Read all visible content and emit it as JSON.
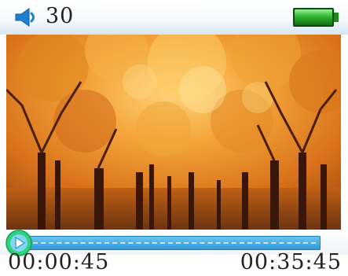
{
  "status": {
    "volume_icon": "speaker-icon",
    "volume_value": "30",
    "battery_icon": "battery-icon",
    "battery_level": 1.0,
    "battery_color": "#2fb52f"
  },
  "player": {
    "video_description": "autumn forest",
    "progress": 0.02,
    "elapsed": "00:00:45",
    "duration": "00:35:45",
    "play_icon": "play-icon",
    "knob_color": "#2fd37a",
    "track_color": "#3aa6e0"
  }
}
